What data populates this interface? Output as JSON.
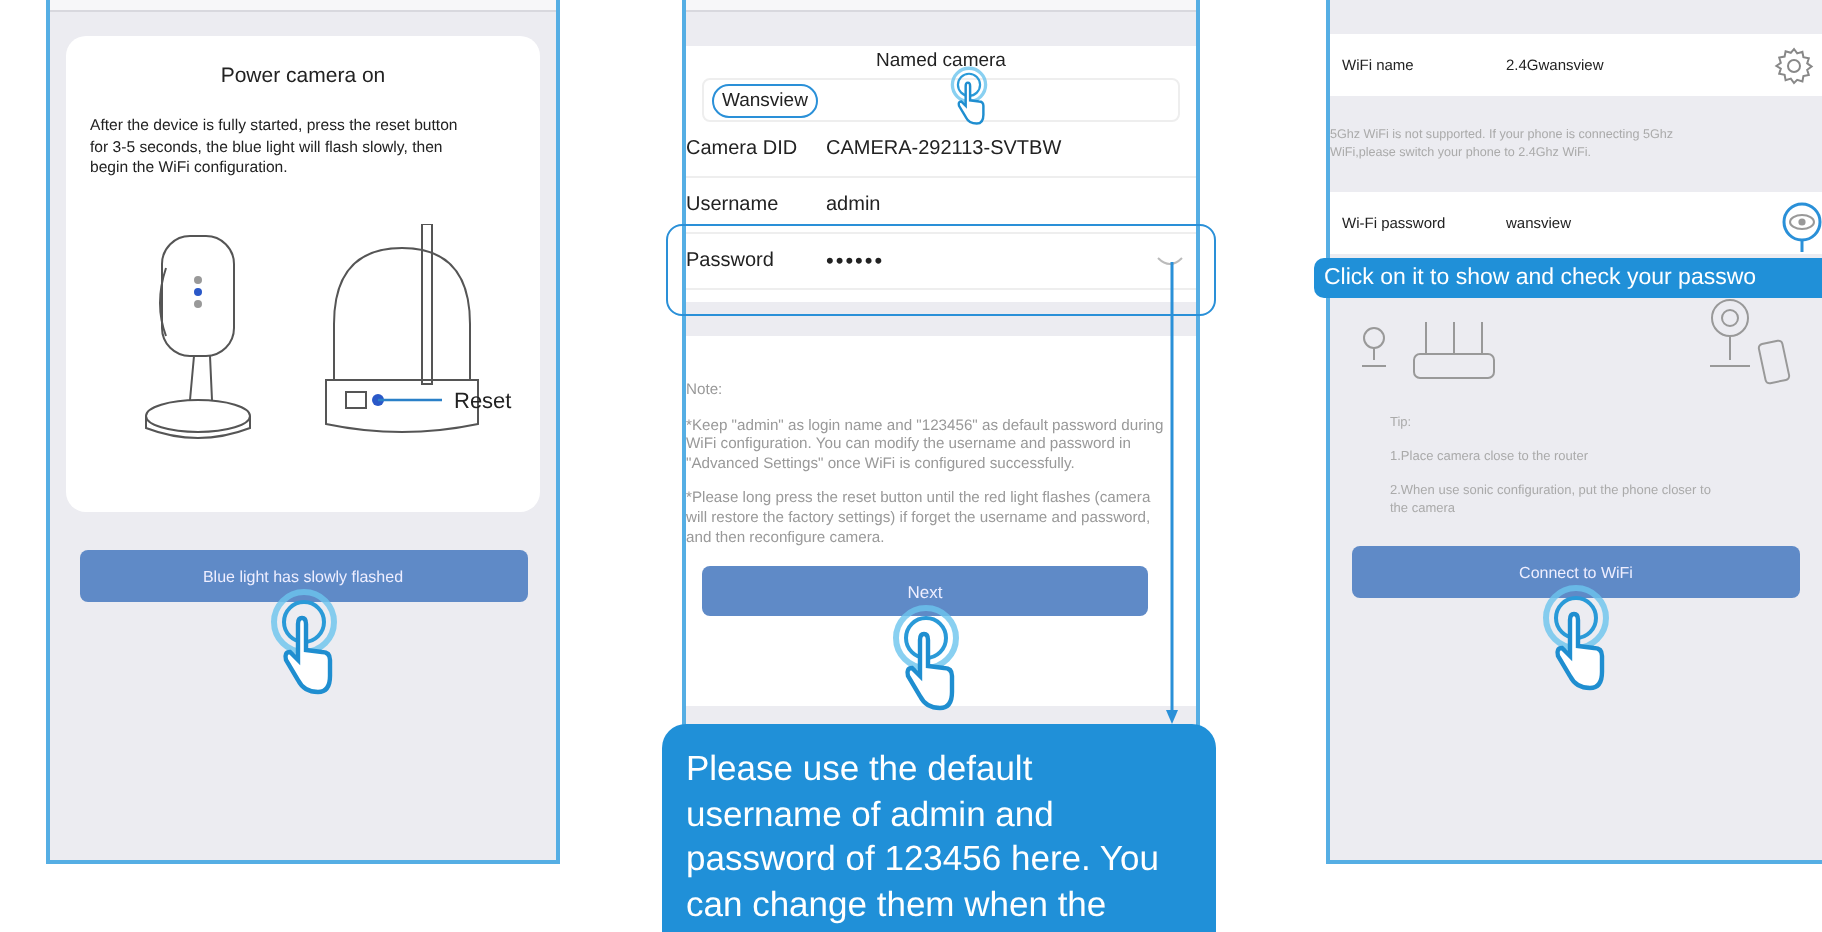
{
  "power_step": {
    "title": "Power camera on",
    "instructions": "After the device is fully started, press the reset button for 3-5 seconds, the blue light will flash slowly, then begin the WiFi configuration.",
    "reset_label": "Reset",
    "button": "Blue light has slowly flashed"
  },
  "camera_step": {
    "title": "Named camera",
    "name_value": "Wansview",
    "fields": [
      {
        "label": "Camera DID",
        "value": "CAMERA-292113-SVTBW",
        "kind": "text"
      },
      {
        "label": "Username",
        "value": "admin",
        "kind": "text"
      },
      {
        "label": "Password",
        "value": "••••••",
        "kind": "password"
      }
    ],
    "note_title": "Note:",
    "notes": [
      "*Keep \"admin\" as login name and \"123456\" as default password during WiFi configuration. You can modify the username and password in \"Advanced Settings\" once WiFi is configured successfully.",
      "*Please long press the reset button until the red light flashes (camera will restore the factory settings) if forget the username and password, and then reconfigure camera."
    ],
    "button": "Next",
    "callout": "Please use the default username of admin and password of 123456 here. You can change them when the"
  },
  "wifi_step": {
    "wifi_name_label": "WiFi name",
    "wifi_name": "2.4Gwansview",
    "warning": "5Ghz WiFi is not supported. If your phone is connecting 5Ghz WiFi,please switch your phone to 2.4Ghz WiFi.",
    "password_label": "Wi-Fi password",
    "password": "wansview",
    "callout": "Click on it to show and check your passwo",
    "tip_title": "Tip:",
    "tips": [
      "1.Place camera close to the router",
      "2.When use sonic configuration, put the phone closer to the camera"
    ],
    "button": "Connect to WiFi"
  }
}
